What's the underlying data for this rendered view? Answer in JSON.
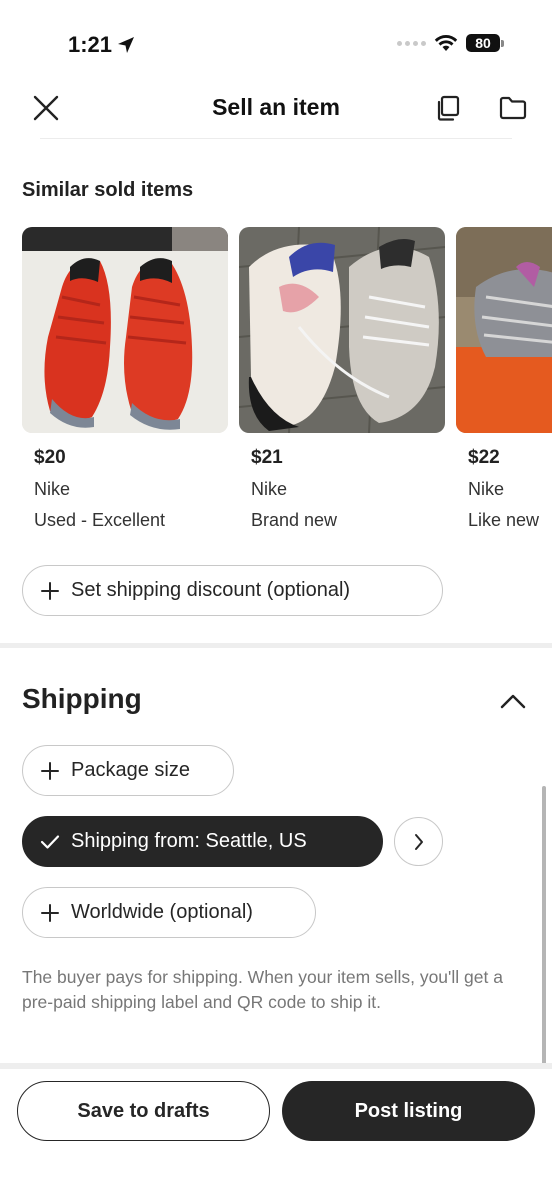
{
  "status_bar": {
    "time": "1:21",
    "battery": "80"
  },
  "header": {
    "title": "Sell an item"
  },
  "similar": {
    "heading": "Similar sold items",
    "items": [
      {
        "price": "$20",
        "brand": "Nike",
        "condition": "Used - Excellent"
      },
      {
        "price": "$21",
        "brand": "Nike",
        "condition": "Brand new"
      },
      {
        "price": "$22",
        "brand": "Nike",
        "condition": "Like new"
      }
    ]
  },
  "discount": {
    "label": "Set shipping discount (optional)"
  },
  "shipping": {
    "heading": "Shipping",
    "package_size": "Package size",
    "shipping_from": "Shipping from: Seattle, US",
    "worldwide": "Worldwide (optional)",
    "info": "The buyer pays for shipping. When your item sells, you'll get a pre-paid shipping label and QR code to ship it."
  },
  "actions": {
    "save_drafts": "Save to drafts",
    "post_listing": "Post listing"
  },
  "colors": {
    "primary_dark": "#262626",
    "chip_border": "#c8c8c8",
    "muted_text": "#777777"
  }
}
